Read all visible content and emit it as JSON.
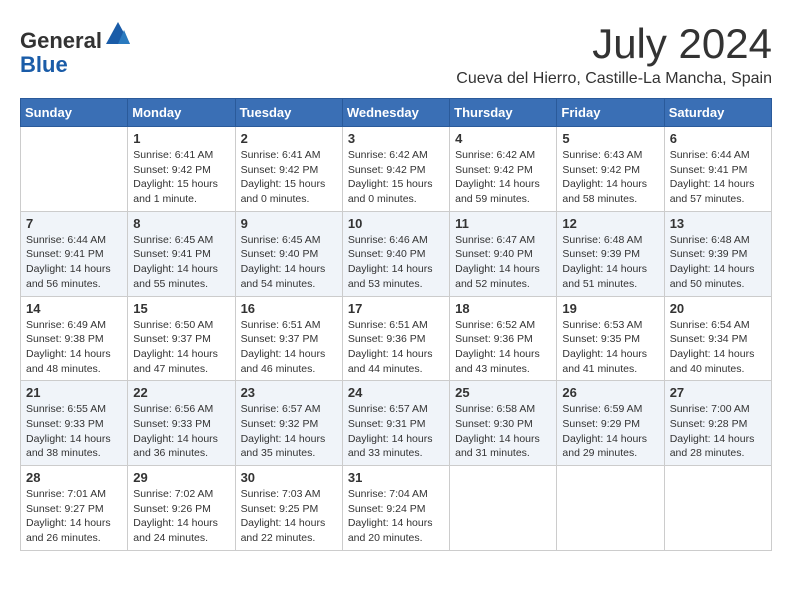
{
  "header": {
    "logo_line1": "General",
    "logo_line2": "Blue",
    "month_year": "July 2024",
    "location": "Cueva del Hierro, Castille-La Mancha, Spain"
  },
  "days_of_week": [
    "Sunday",
    "Monday",
    "Tuesday",
    "Wednesday",
    "Thursday",
    "Friday",
    "Saturday"
  ],
  "weeks": [
    [
      {
        "day": "",
        "info": ""
      },
      {
        "day": "1",
        "info": "Sunrise: 6:41 AM\nSunset: 9:42 PM\nDaylight: 15 hours\nand 1 minute."
      },
      {
        "day": "2",
        "info": "Sunrise: 6:41 AM\nSunset: 9:42 PM\nDaylight: 15 hours\nand 0 minutes."
      },
      {
        "day": "3",
        "info": "Sunrise: 6:42 AM\nSunset: 9:42 PM\nDaylight: 15 hours\nand 0 minutes."
      },
      {
        "day": "4",
        "info": "Sunrise: 6:42 AM\nSunset: 9:42 PM\nDaylight: 14 hours\nand 59 minutes."
      },
      {
        "day": "5",
        "info": "Sunrise: 6:43 AM\nSunset: 9:42 PM\nDaylight: 14 hours\nand 58 minutes."
      },
      {
        "day": "6",
        "info": "Sunrise: 6:44 AM\nSunset: 9:41 PM\nDaylight: 14 hours\nand 57 minutes."
      }
    ],
    [
      {
        "day": "7",
        "info": "Sunrise: 6:44 AM\nSunset: 9:41 PM\nDaylight: 14 hours\nand 56 minutes."
      },
      {
        "day": "8",
        "info": "Sunrise: 6:45 AM\nSunset: 9:41 PM\nDaylight: 14 hours\nand 55 minutes."
      },
      {
        "day": "9",
        "info": "Sunrise: 6:45 AM\nSunset: 9:40 PM\nDaylight: 14 hours\nand 54 minutes."
      },
      {
        "day": "10",
        "info": "Sunrise: 6:46 AM\nSunset: 9:40 PM\nDaylight: 14 hours\nand 53 minutes."
      },
      {
        "day": "11",
        "info": "Sunrise: 6:47 AM\nSunset: 9:40 PM\nDaylight: 14 hours\nand 52 minutes."
      },
      {
        "day": "12",
        "info": "Sunrise: 6:48 AM\nSunset: 9:39 PM\nDaylight: 14 hours\nand 51 minutes."
      },
      {
        "day": "13",
        "info": "Sunrise: 6:48 AM\nSunset: 9:39 PM\nDaylight: 14 hours\nand 50 minutes."
      }
    ],
    [
      {
        "day": "14",
        "info": "Sunrise: 6:49 AM\nSunset: 9:38 PM\nDaylight: 14 hours\nand 48 minutes."
      },
      {
        "day": "15",
        "info": "Sunrise: 6:50 AM\nSunset: 9:37 PM\nDaylight: 14 hours\nand 47 minutes."
      },
      {
        "day": "16",
        "info": "Sunrise: 6:51 AM\nSunset: 9:37 PM\nDaylight: 14 hours\nand 46 minutes."
      },
      {
        "day": "17",
        "info": "Sunrise: 6:51 AM\nSunset: 9:36 PM\nDaylight: 14 hours\nand 44 minutes."
      },
      {
        "day": "18",
        "info": "Sunrise: 6:52 AM\nSunset: 9:36 PM\nDaylight: 14 hours\nand 43 minutes."
      },
      {
        "day": "19",
        "info": "Sunrise: 6:53 AM\nSunset: 9:35 PM\nDaylight: 14 hours\nand 41 minutes."
      },
      {
        "day": "20",
        "info": "Sunrise: 6:54 AM\nSunset: 9:34 PM\nDaylight: 14 hours\nand 40 minutes."
      }
    ],
    [
      {
        "day": "21",
        "info": "Sunrise: 6:55 AM\nSunset: 9:33 PM\nDaylight: 14 hours\nand 38 minutes."
      },
      {
        "day": "22",
        "info": "Sunrise: 6:56 AM\nSunset: 9:33 PM\nDaylight: 14 hours\nand 36 minutes."
      },
      {
        "day": "23",
        "info": "Sunrise: 6:57 AM\nSunset: 9:32 PM\nDaylight: 14 hours\nand 35 minutes."
      },
      {
        "day": "24",
        "info": "Sunrise: 6:57 AM\nSunset: 9:31 PM\nDaylight: 14 hours\nand 33 minutes."
      },
      {
        "day": "25",
        "info": "Sunrise: 6:58 AM\nSunset: 9:30 PM\nDaylight: 14 hours\nand 31 minutes."
      },
      {
        "day": "26",
        "info": "Sunrise: 6:59 AM\nSunset: 9:29 PM\nDaylight: 14 hours\nand 29 minutes."
      },
      {
        "day": "27",
        "info": "Sunrise: 7:00 AM\nSunset: 9:28 PM\nDaylight: 14 hours\nand 28 minutes."
      }
    ],
    [
      {
        "day": "28",
        "info": "Sunrise: 7:01 AM\nSunset: 9:27 PM\nDaylight: 14 hours\nand 26 minutes."
      },
      {
        "day": "29",
        "info": "Sunrise: 7:02 AM\nSunset: 9:26 PM\nDaylight: 14 hours\nand 24 minutes."
      },
      {
        "day": "30",
        "info": "Sunrise: 7:03 AM\nSunset: 9:25 PM\nDaylight: 14 hours\nand 22 minutes."
      },
      {
        "day": "31",
        "info": "Sunrise: 7:04 AM\nSunset: 9:24 PM\nDaylight: 14 hours\nand 20 minutes."
      },
      {
        "day": "",
        "info": ""
      },
      {
        "day": "",
        "info": ""
      },
      {
        "day": "",
        "info": ""
      }
    ]
  ]
}
